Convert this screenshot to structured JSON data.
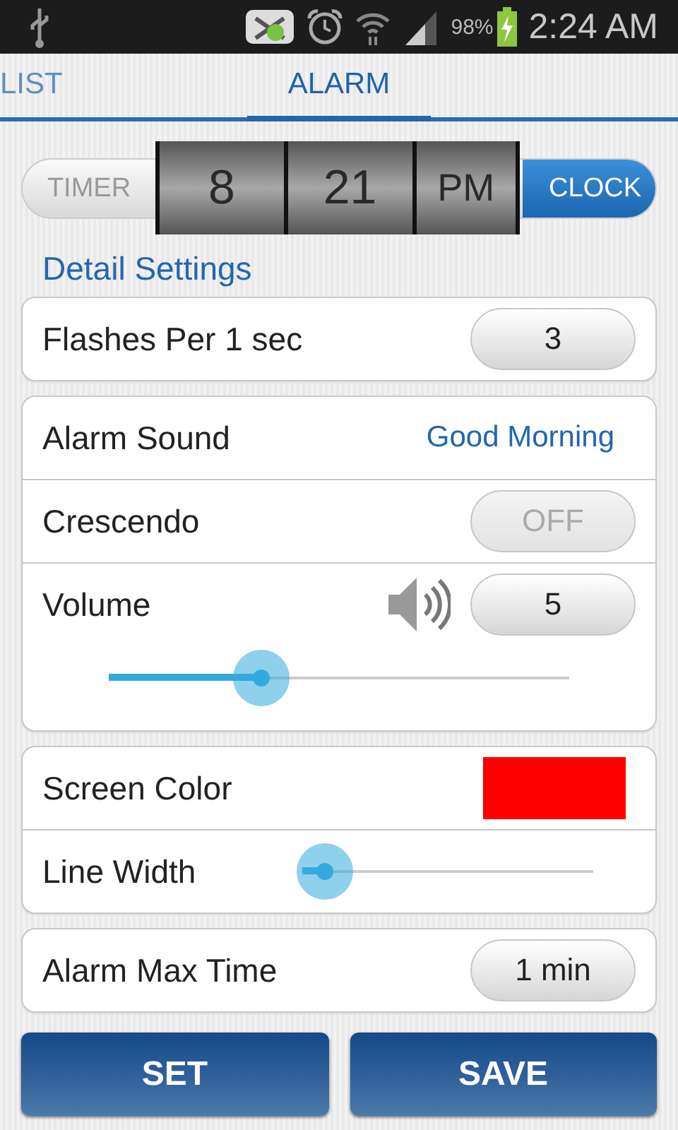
{
  "status_bar": {
    "battery": "98%",
    "time": "2:24 AM"
  },
  "tabs": [
    {
      "label": "LIST",
      "selected": false
    },
    {
      "label": "ALARM",
      "selected": true
    }
  ],
  "mode": {
    "options": [
      {
        "label": "TIMER",
        "selected": false
      },
      {
        "label": "CLOCK",
        "selected": true
      }
    ],
    "time": [
      "8",
      "21",
      "PM"
    ]
  },
  "section_title": "Detail Settings",
  "cards": [
    {
      "rows": [
        {
          "kind": "button",
          "label": "Flashes Per 1 sec",
          "value": "3"
        }
      ]
    },
    {
      "rows": [
        {
          "kind": "link",
          "label": "Alarm Sound",
          "value": "Good Morning"
        },
        {
          "kind": "toggle",
          "label": "Crescendo",
          "value": "OFF",
          "on": false
        },
        {
          "kind": "volume",
          "label": "Volume",
          "value": "5",
          "level": 0.33
        }
      ]
    },
    {
      "rows": [
        {
          "kind": "color",
          "label": "Screen Color",
          "color": "#ff0000"
        },
        {
          "kind": "slider",
          "label": "Line Width",
          "level": 0.08
        }
      ]
    },
    {
      "rows": [
        {
          "kind": "button",
          "label": "Alarm Max Time",
          "value": "1 min"
        }
      ]
    }
  ],
  "buttons": [
    "SET",
    "SAVE"
  ]
}
